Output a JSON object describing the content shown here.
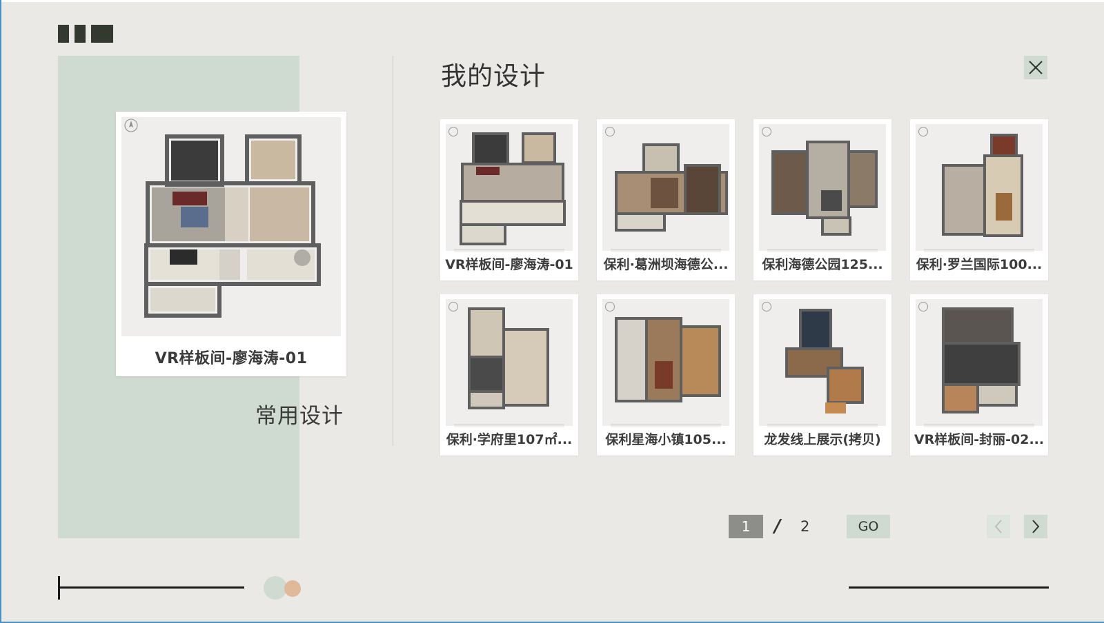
{
  "page": {
    "title": "我的设计",
    "common_design_label": "常用设计"
  },
  "featured": {
    "caption": "VR样板间-廖海涛-01"
  },
  "designs": [
    {
      "caption": "VR样板间-廖海涛-01"
    },
    {
      "caption": "保利·葛洲坝海德公..."
    },
    {
      "caption": "保利海德公园125..."
    },
    {
      "caption": "保利·罗兰国际100..."
    },
    {
      "caption": "保利·学府里107㎡..."
    },
    {
      "caption": "保利星海小镇105..."
    },
    {
      "caption": "龙发线上展示(拷贝)"
    },
    {
      "caption": "VR样板间-封丽-02..."
    }
  ],
  "pagination": {
    "current": "1",
    "separator": "/",
    "total": "2",
    "go_label": "GO"
  },
  "icons": {
    "close": "close-icon",
    "prev": "chevron-left-icon",
    "next": "chevron-right-icon"
  },
  "colors": {
    "accent_green": "#cfdbd1",
    "accent_tan": "#dfb99a",
    "background": "#ebe9e6"
  }
}
